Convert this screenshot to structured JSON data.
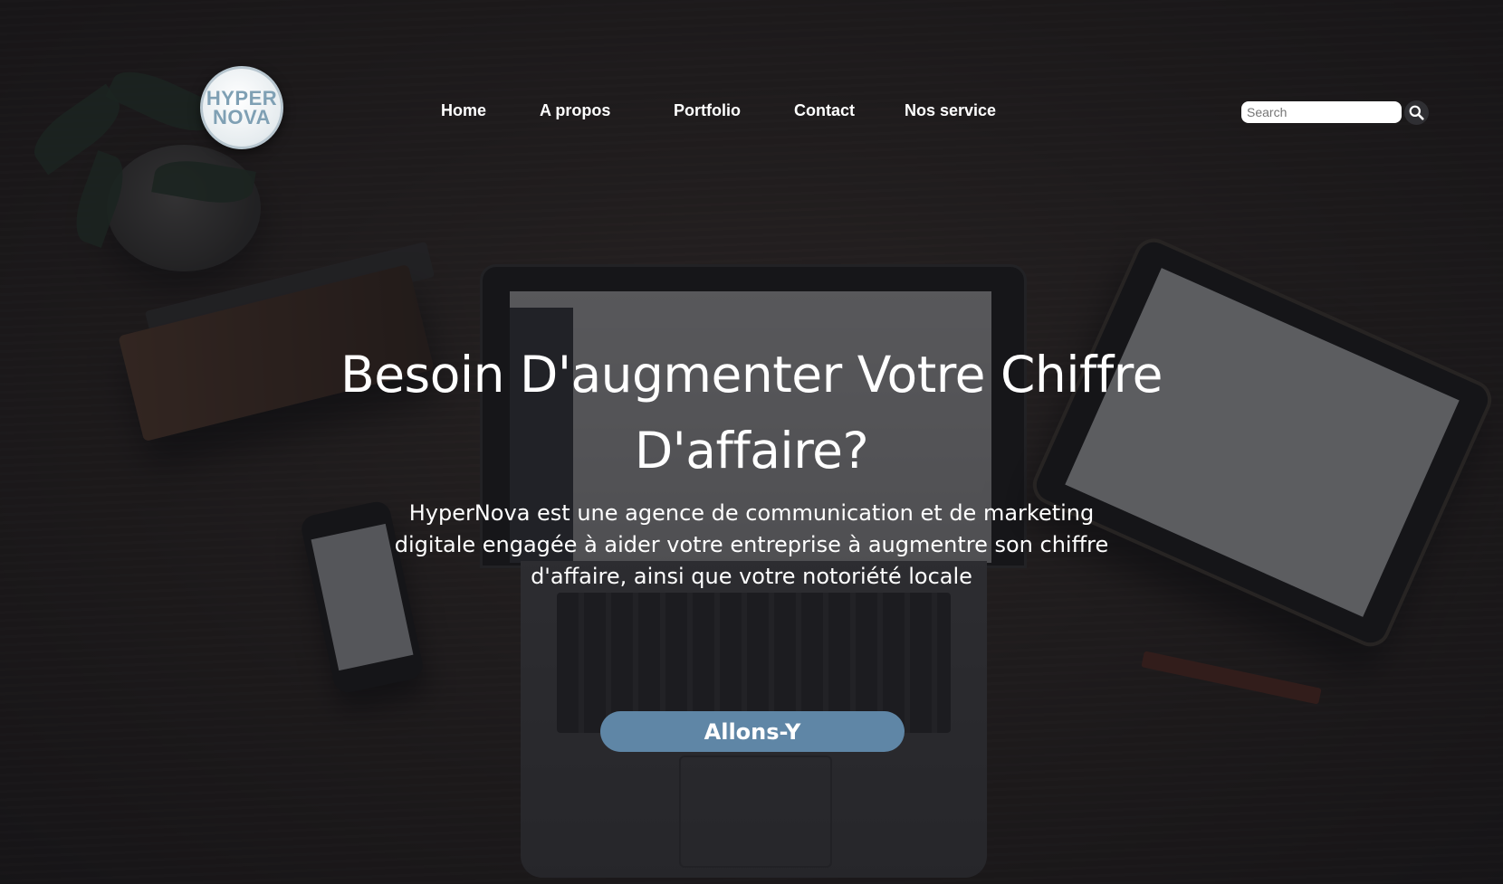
{
  "logo": {
    "line1": "HYPER",
    "line2": "NOVA"
  },
  "nav": {
    "items": [
      {
        "label": "Home"
      },
      {
        "label": "A propos"
      },
      {
        "label": "Portfolio"
      },
      {
        "label": "Contact"
      },
      {
        "label": "Nos service"
      }
    ]
  },
  "search": {
    "placeholder": "Search",
    "value": "",
    "icon": "search-icon"
  },
  "hero": {
    "title": "Besoin D'augmenter Votre Chiffre D'affaire?",
    "description": "HyperNova est une agence de communication et de marketing digitale engagée à aider votre entreprise à augmentre son chiffre d'affaire, ainsi que votre notoriété locale",
    "cta_label": "Allons-Y"
  },
  "colors": {
    "cta": "#5f86a6",
    "logo_text": "#7fa0b4",
    "overlay": "#16161a"
  }
}
